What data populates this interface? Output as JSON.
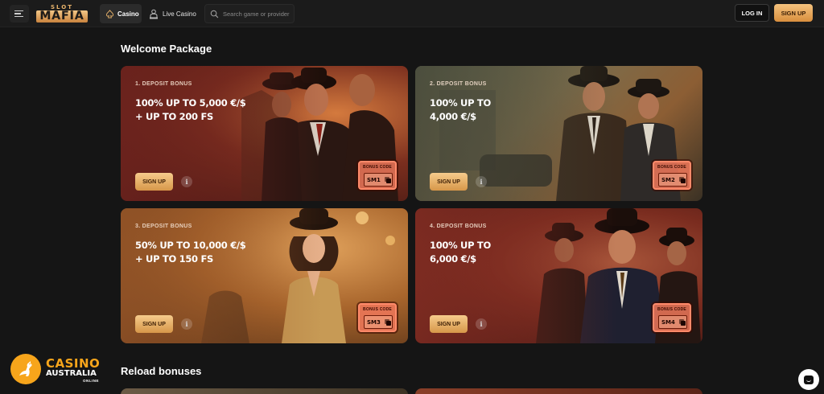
{
  "header": {
    "logo_top": "SLOT",
    "logo_main": "MAFIA",
    "nav": {
      "casino": "Casino",
      "live_casino": "Live Casino"
    },
    "search_placeholder": "Search game or provider",
    "login_label": "LOG IN",
    "signup_label": "SIGN UP"
  },
  "welcome": {
    "title": "Welcome Package",
    "cards": [
      {
        "label": "1. DEPOSIT BONUS",
        "offer": "100% UP TO 5,000 €/$\n+ UP TO 200 FS",
        "signup_label": "SIGN UP",
        "info_label": "i",
        "code_title": "BONUS CODE",
        "code": "SM1"
      },
      {
        "label": "2. DEPOSIT BONUS",
        "offer": "100% UP TO\n4,000 €/$",
        "signup_label": "SIGN UP",
        "info_label": "i",
        "code_title": "BONUS CODE",
        "code": "SM2"
      },
      {
        "label": "3. DEPOSIT BONUS",
        "offer": "50% UP TO 10,000 €/$\n+ UP TO 150 FS",
        "signup_label": "SIGN UP",
        "info_label": "i",
        "code_title": "BONUS CODE",
        "code": "SM3"
      },
      {
        "label": "4. DEPOSIT BONUS",
        "offer": "100% UP TO\n6,000 €/$",
        "signup_label": "SIGN UP",
        "info_label": "i",
        "code_title": "BONUS CODE",
        "code": "SM4"
      }
    ]
  },
  "reload": {
    "title": "Reload bonuses"
  },
  "watermark": {
    "line1": "CASINO",
    "line2": "AUSTRALIA",
    "line3": "ONLINE"
  },
  "colors": {
    "accent": "#e8a45a",
    "background": "#151515",
    "code_border": "#ff8a6a"
  },
  "icons": {
    "menu": "hamburger-icon",
    "casino": "spade-icon",
    "live_casino": "dealer-icon",
    "search": "search-icon",
    "copy": "copy-icon",
    "info": "info-icon",
    "chat": "chat-icon"
  }
}
